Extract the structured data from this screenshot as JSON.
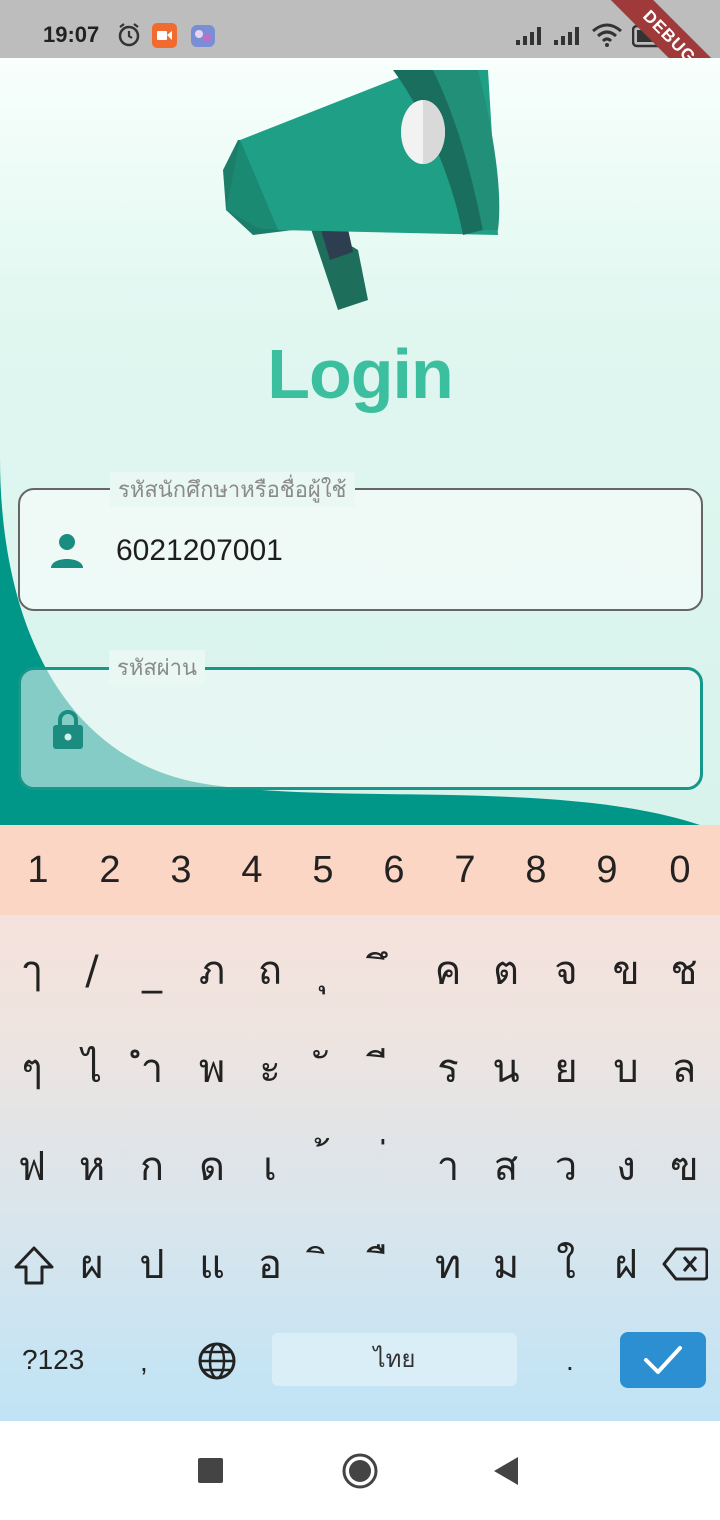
{
  "status_bar": {
    "time": "19:07",
    "icons": [
      "alarm-icon",
      "screen-record-icon",
      "app-notification-icon",
      "signal-icon",
      "signal-icon",
      "wifi-icon",
      "battery-icon"
    ],
    "debug_banner": "DEBUG"
  },
  "login": {
    "title": "Login",
    "username": {
      "label": "รหัสนักศึกษาหรือชื่อผู้ใช้",
      "value": "6021207001",
      "icon": "person-icon"
    },
    "password": {
      "label": "รหัสผ่าน",
      "value": "",
      "icon": "lock-icon"
    },
    "colors": {
      "accent": "#3cbf9f",
      "teal": "#009688",
      "field_border_focus": "#17968a"
    }
  },
  "keyboard": {
    "number_row": [
      "1",
      "2",
      "3",
      "4",
      "5",
      "6",
      "7",
      "8",
      "9",
      "0"
    ],
    "rows": [
      [
        "ๅ",
        "/",
        "_",
        "ภ",
        "ถ",
        "ุ",
        "ึ",
        "ค",
        "ต",
        "จ",
        "ข",
        "ช"
      ],
      [
        "ๆ",
        "ไ",
        "ำ",
        "พ",
        "ะ",
        "ั",
        "ี",
        "ร",
        "น",
        "ย",
        "บ",
        "ล"
      ],
      [
        "ฟ",
        "ห",
        "ก",
        "ด",
        "เ",
        "้",
        "่",
        "า",
        "ส",
        "ว",
        "ง",
        "ฃ"
      ],
      [
        "ผ",
        "ป",
        "แ",
        "อ",
        "ิ",
        "ื",
        "ท",
        "ม",
        "ใ",
        "ฝ"
      ]
    ],
    "symbols_key": "?123",
    "comma_key": ",",
    "space_label": "ไทย",
    "period_key": ".",
    "icons": {
      "shift": "shift-icon",
      "backspace": "backspace-icon",
      "language": "globe-icon",
      "done": "check-icon"
    }
  },
  "nav_bar": {
    "icons": [
      "recents-icon",
      "home-icon",
      "back-icon"
    ]
  }
}
